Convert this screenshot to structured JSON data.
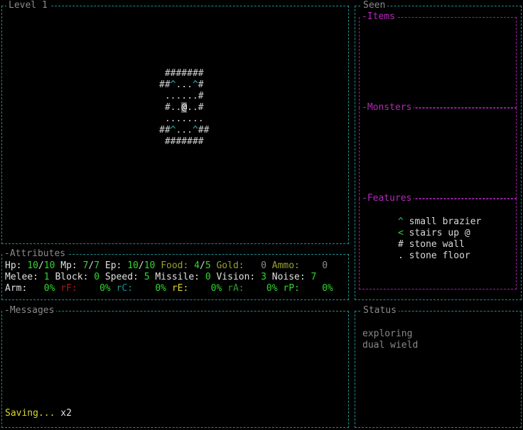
{
  "level_panel": {
    "title": "Level 1"
  },
  "map_rows": [
    [
      {
        "t": " #######",
        "c": ""
      }
    ],
    [
      {
        "t": "##",
        "c": ""
      },
      {
        "t": "^",
        "c": "b"
      },
      {
        "t": "...",
        "c": ""
      },
      {
        "t": "^",
        "c": "b"
      },
      {
        "t": "#",
        "c": ""
      }
    ],
    [
      {
        "t": " ......#",
        "c": ""
      }
    ],
    [
      {
        "t": " #..",
        "c": ""
      },
      {
        "t": "@",
        "c": "p"
      },
      {
        "t": "..#",
        "c": ""
      }
    ],
    [
      {
        "t": " .......",
        "c": ""
      }
    ],
    [
      {
        "t": "##",
        "c": ""
      },
      {
        "t": "^",
        "c": "b"
      },
      {
        "t": "...",
        "c": ""
      },
      {
        "t": "^",
        "c": "b"
      },
      {
        "t": "##",
        "c": ""
      }
    ],
    [
      {
        "t": " #######",
        "c": ""
      }
    ]
  ],
  "seen_panel": {
    "title": "Seen"
  },
  "items_panel": {
    "title": "-Items"
  },
  "monsters_panel": {
    "title": "-Monsters"
  },
  "features_panel": {
    "title": "-Features",
    "items": [
      {
        "glyph": "^",
        "label": "small brazier"
      },
      {
        "glyph": "<",
        "label": "stairs up @"
      },
      {
        "glyph": "#",
        "label": "stone wall"
      },
      {
        "glyph": ".",
        "label": "stone floor"
      }
    ]
  },
  "attributes_panel": {
    "title": "-Attributes",
    "hp_label": "Hp:",
    "hp_cur": "10",
    "hp_max": "10",
    "mp_label": "Mp:",
    "mp_cur": "7",
    "mp_max": "7",
    "ep_label": "Ep:",
    "ep_cur": "10",
    "ep_max": "10",
    "food_label": "Food:",
    "food_cur": "4",
    "food_max": "5",
    "gold_label": "Gold:",
    "gold": "0",
    "ammo_label": "Ammo:",
    "ammo": "0",
    "melee_label": "Melee:",
    "melee": "1",
    "block_label": "Block:",
    "block": "0",
    "speed_label": "Speed:",
    "speed": "5",
    "missile_label": "Missile:",
    "missile": "0",
    "vision_label": "Vision:",
    "vision": "3",
    "noise_label": "Noise:",
    "noise": "7",
    "arm_label": "Arm:",
    "arm": "0%",
    "rf_label": "rF:",
    "rf": "0%",
    "rc_label": "rC:",
    "rc": "0%",
    "re_label": "rE:",
    "re": "0%",
    "ra_label": "rA:",
    "ra": "0%",
    "rp_label": "rP:",
    "rp": "0%"
  },
  "messages_panel": {
    "title": "-Messages",
    "last_message": "Saving...",
    "last_count": "x2"
  },
  "status_panel": {
    "title": "Status",
    "lines": [
      "exploring",
      "dual wield"
    ]
  }
}
